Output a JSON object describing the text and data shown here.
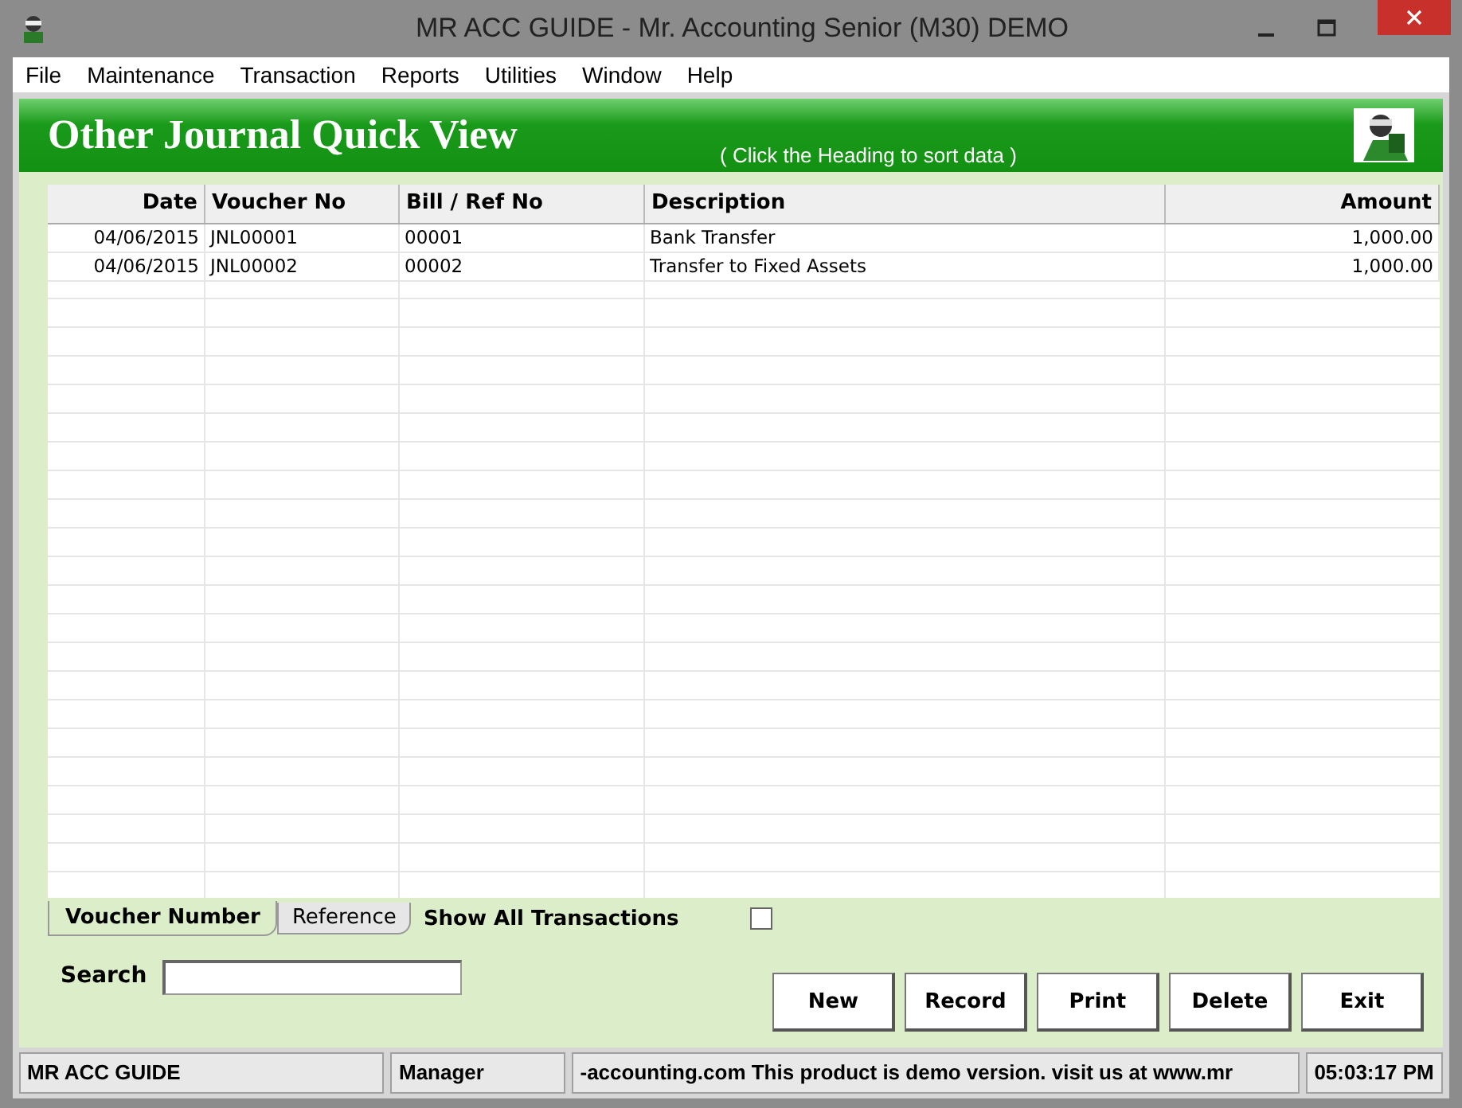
{
  "window": {
    "title": "MR ACC GUIDE - Mr. Accounting Senior (M30) DEMO"
  },
  "menu": [
    "File",
    "Maintenance",
    "Transaction",
    "Reports",
    "Utilities",
    "Window",
    "Help"
  ],
  "header": {
    "title": "Other Journal Quick View",
    "hint": "( Click the Heading to sort data )"
  },
  "table": {
    "columns": [
      {
        "label": "Date",
        "kind": "numeric"
      },
      {
        "label": "Voucher No",
        "kind": "text"
      },
      {
        "label": "Bill / Ref No",
        "kind": "text"
      },
      {
        "label": "Description",
        "kind": "text"
      },
      {
        "label": "Amount",
        "kind": "numeric"
      }
    ],
    "rows": [
      [
        "04/06/2015",
        "JNL00001",
        "00001",
        "Bank Transfer",
        "1,000.00"
      ],
      [
        "04/06/2015",
        "JNL00002",
        "00002",
        "Transfer to Fixed Assets",
        "1,000.00"
      ]
    ]
  },
  "tabs": [
    {
      "label": "Voucher Number",
      "selected": true
    },
    {
      "label": "Reference",
      "selected": false
    }
  ],
  "show_all": {
    "label": "Show All Transactions",
    "checked": false
  },
  "search": {
    "label": "Search"
  },
  "buttons": [
    "New",
    "Record",
    "Print",
    "Delete",
    "Exit"
  ],
  "status_bar": [
    "MR ACC GUIDE",
    "Manager",
    "-accounting.com This product is demo version.  visit us at www.mr",
    "05:03:17 PM"
  ]
}
